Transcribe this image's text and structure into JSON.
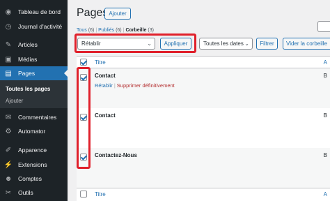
{
  "sidebar": {
    "items": [
      {
        "icon": "dashboard-icon",
        "glyph": "◉",
        "label": "Tableau de bord"
      },
      {
        "icon": "activity-log-icon",
        "glyph": "◷",
        "label": "Journal d'activité"
      },
      {
        "icon": "pin-icon",
        "glyph": "✎",
        "label": "Articles"
      },
      {
        "icon": "media-icon",
        "glyph": "▣",
        "label": "Médias"
      },
      {
        "icon": "pages-icon",
        "glyph": "▤",
        "label": "Pages"
      },
      {
        "icon": "comments-icon",
        "glyph": "✉",
        "label": "Commentaires"
      },
      {
        "icon": "automator-icon",
        "glyph": "⚙",
        "label": "Automator"
      },
      {
        "icon": "appearance-icon",
        "glyph": "✐",
        "label": "Apparence"
      },
      {
        "icon": "plugins-icon",
        "glyph": "⚡",
        "label": "Extensions"
      },
      {
        "icon": "users-icon",
        "glyph": "☻",
        "label": "Comptes"
      },
      {
        "icon": "tools-icon",
        "glyph": "✂",
        "label": "Outils"
      }
    ],
    "submenu": [
      "Toutes les pages",
      "Ajouter"
    ]
  },
  "header": {
    "title": "Pages",
    "add_label": "Ajouter"
  },
  "views": {
    "all": "Tous",
    "all_count": "(6)",
    "published": "Publiés",
    "published_count": "(6)",
    "trash": "Corbeille",
    "trash_count": "(3)",
    "sep": "|"
  },
  "toolbar": {
    "bulk_action": "Rétablir",
    "apply_label": "Appliquer",
    "dates": "Toutes les dates",
    "filter_label": "Filtrer",
    "empty_trash_label": "Vider la corbeille"
  },
  "table": {
    "col_title": "Titre",
    "col_author_initial": "A",
    "rows": [
      {
        "title": "Contact",
        "col_b": "B",
        "actions": {
          "restore": "Rétablir",
          "delete": "Supprimer définitivement",
          "sep": "|"
        }
      },
      {
        "title": "Contact",
        "col_b": "B"
      },
      {
        "title": "Contactez-Nous",
        "col_b": "B"
      }
    ]
  },
  "colors": {
    "sidebar_bg": "#1d2327",
    "active_menu": "#2271b1",
    "link": "#2271b1",
    "delete": "#b32d2e",
    "highlight": "#e0202b"
  }
}
